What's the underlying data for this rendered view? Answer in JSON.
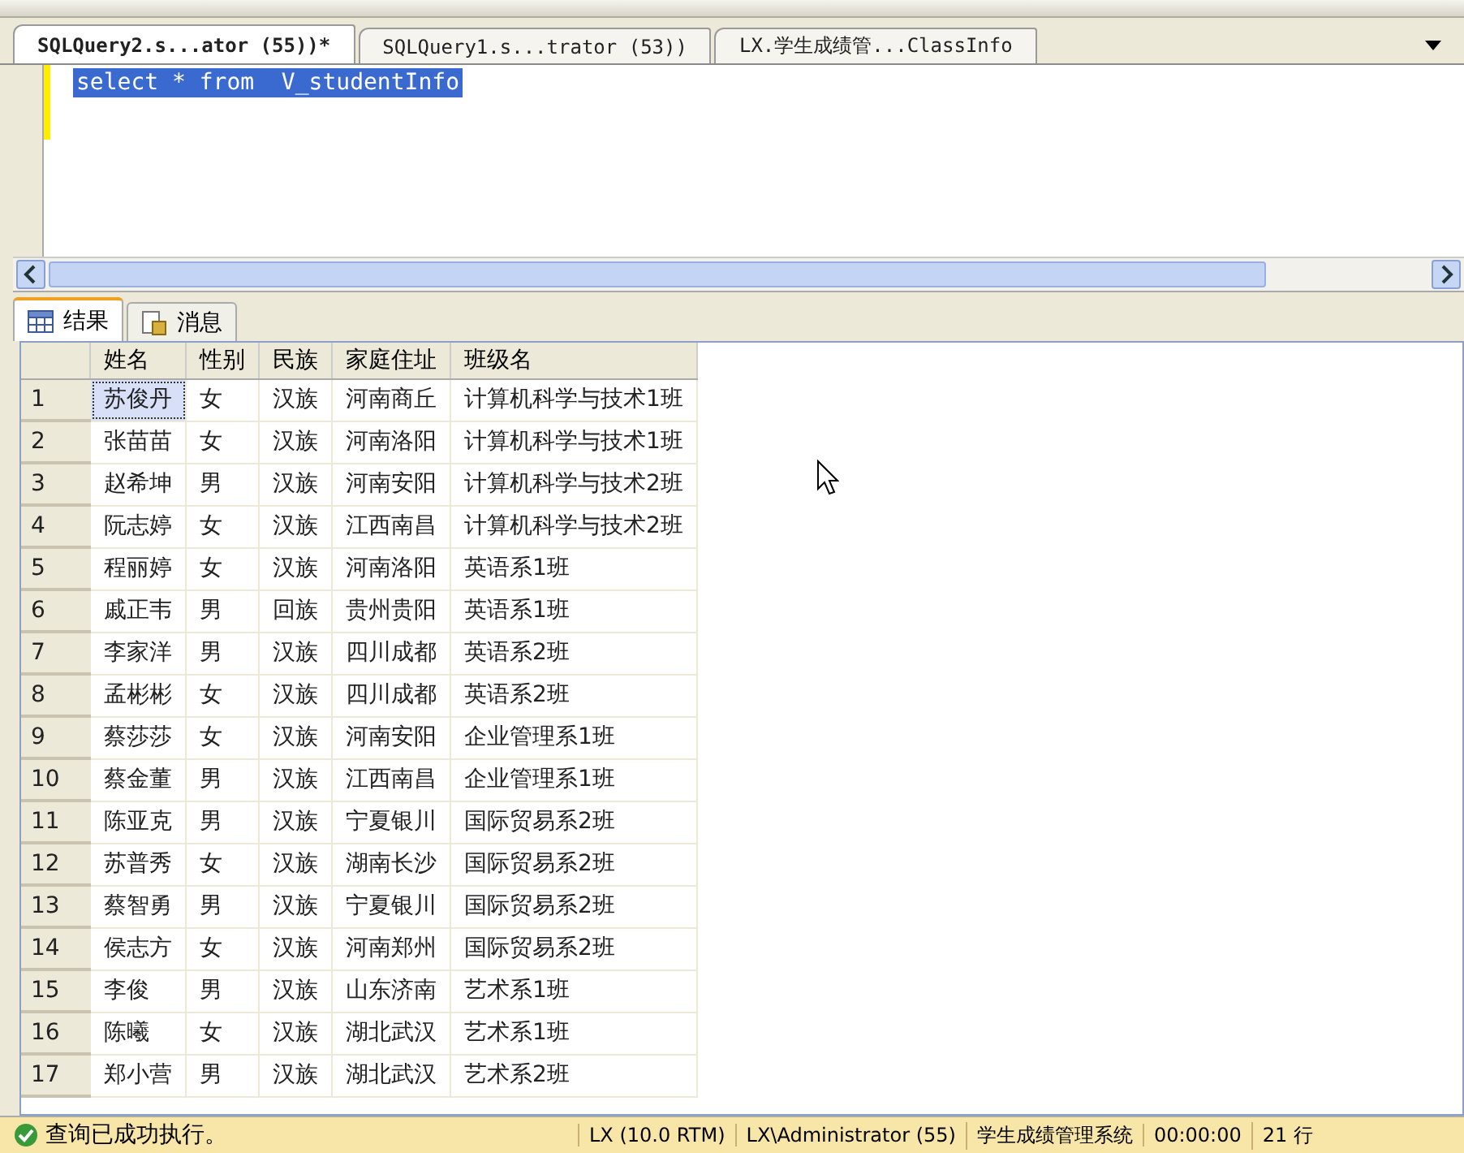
{
  "doc_tabs": [
    {
      "label": "SQLQuery2.s...ator (55))*",
      "selected": true
    },
    {
      "label": "SQLQuery1.s...trator (53))",
      "selected": false
    },
    {
      "label": "LX.学生成绩管...ClassInfo",
      "selected": false
    }
  ],
  "editor": {
    "lines": [
      {
        "text": "select * from  V_studentInfo",
        "selected": true
      }
    ]
  },
  "result_tabs": [
    {
      "label": "结果",
      "kind": "grid",
      "selected": true
    },
    {
      "label": "消息",
      "kind": "messages",
      "selected": false
    }
  ],
  "table": {
    "columns": [
      "姓名",
      "性别",
      "民族",
      "家庭住址",
      "班级名"
    ],
    "rows": [
      {
        "num": "1",
        "cells": [
          "苏俊丹",
          "女",
          "汉族",
          "河南商丘",
          "计算机科学与技术1班"
        ],
        "current": true
      },
      {
        "num": "2",
        "cells": [
          "张苗苗",
          "女",
          "汉族",
          "河南洛阳",
          "计算机科学与技术1班"
        ],
        "current": false
      },
      {
        "num": "3",
        "cells": [
          "赵希坤",
          "男",
          "汉族",
          "河南安阳",
          "计算机科学与技术2班"
        ],
        "current": false
      },
      {
        "num": "4",
        "cells": [
          "阮志婷",
          "女",
          "汉族",
          "江西南昌",
          "计算机科学与技术2班"
        ],
        "current": false
      },
      {
        "num": "5",
        "cells": [
          "程丽婷",
          "女",
          "汉族",
          "河南洛阳",
          "英语系1班"
        ],
        "current": false
      },
      {
        "num": "6",
        "cells": [
          "戚正韦",
          "男",
          "回族",
          "贵州贵阳",
          "英语系1班"
        ],
        "current": false
      },
      {
        "num": "7",
        "cells": [
          "李家洋",
          "男",
          "汉族",
          "四川成都",
          "英语系2班"
        ],
        "current": false
      },
      {
        "num": "8",
        "cells": [
          "孟彬彬",
          "女",
          "汉族",
          "四川成都",
          "英语系2班"
        ],
        "current": false
      },
      {
        "num": "9",
        "cells": [
          "蔡莎莎",
          "女",
          "汉族",
          "河南安阳",
          "企业管理系1班"
        ],
        "current": false
      },
      {
        "num": "10",
        "cells": [
          "蔡金董",
          "男",
          "汉族",
          "江西南昌",
          "企业管理系1班"
        ],
        "current": false
      },
      {
        "num": "11",
        "cells": [
          "陈亚克",
          "男",
          "汉族",
          "宁夏银川",
          "国际贸易系2班"
        ],
        "current": false
      },
      {
        "num": "12",
        "cells": [
          "苏普秀",
          "女",
          "汉族",
          "湖南长沙",
          "国际贸易系2班"
        ],
        "current": false
      },
      {
        "num": "13",
        "cells": [
          "蔡智勇",
          "男",
          "汉族",
          "宁夏银川",
          "国际贸易系2班"
        ],
        "current": false
      },
      {
        "num": "14",
        "cells": [
          "侯志方",
          "女",
          "汉族",
          "河南郑州",
          "国际贸易系2班"
        ],
        "current": false
      },
      {
        "num": "15",
        "cells": [
          "李俊",
          "男",
          "汉族",
          "山东济南",
          "艺术系1班"
        ],
        "current": false
      },
      {
        "num": "16",
        "cells": [
          "陈曦",
          "女",
          "汉族",
          "湖北武汉",
          "艺术系1班"
        ],
        "current": false
      },
      {
        "num": "17",
        "cells": [
          "郑小营",
          "男",
          "汉族",
          "湖北武汉",
          "艺术系2班"
        ],
        "current": false
      }
    ]
  },
  "status_bar": {
    "message": "查询已成功执行。",
    "segments": [
      "LX (10.0 RTM)",
      "LX\\Administrator (55)",
      "学生成绩管理系统",
      "00:00:00",
      "21 行"
    ]
  }
}
